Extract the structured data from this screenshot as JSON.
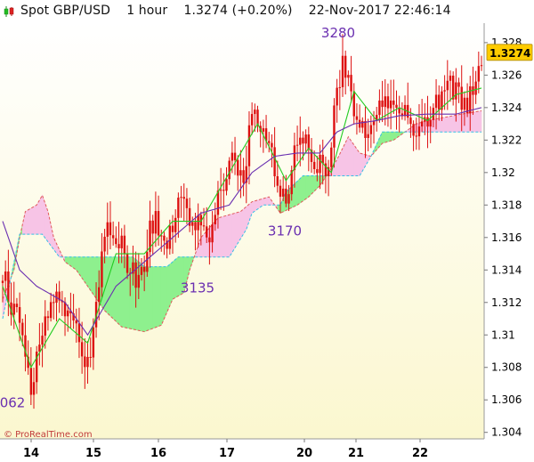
{
  "header": {
    "instrument": "Spot GBP/USD",
    "timeframe": "1 hour",
    "price": "1.3274",
    "change": "(+0.20%)",
    "datetime": "22-Nov-2017 22:46:14"
  },
  "watermark": "© ProRealTime.com",
  "colors": {
    "background_top": "#ffffff",
    "background_bottom": "#fbf7cf",
    "candle": "#dd1010",
    "tenkan": "#22cc22",
    "kijun": "#6a2fb0",
    "kumo_bull": "#8ef08e",
    "kumo_bear": "#f7c4e6",
    "senkou_a_line": "#e05a5a",
    "senkou_b_line": "#35c0e6",
    "price_tag": "#ffcc00"
  },
  "chart_data": {
    "type": "candlestick",
    "indicator": "Ichimoku",
    "ylim": [
      1.3036,
      1.3292
    ],
    "y_ticks": [
      "1.304",
      "1.306",
      "1.308",
      "1.31",
      "1.312",
      "1.314",
      "1.316",
      "1.318",
      "1.32",
      "1.322",
      "1.324",
      "1.326",
      "1.328"
    ],
    "x_ticks": [
      "14",
      "15",
      "16",
      "17",
      "20",
      "21",
      "22"
    ],
    "last_price_label": "1.3274",
    "last_price": 1.3274,
    "annotations": [
      {
        "text": "062",
        "x_day": "14",
        "y": 1.3062
      },
      {
        "text": "3135",
        "x_day": "16",
        "y": 1.3135
      },
      {
        "text": "3170",
        "x_day": "17",
        "y": 1.317
      },
      {
        "text": "3280",
        "x_day": "20",
        "y": 1.328
      }
    ],
    "close_anchors": [
      [
        0,
        1.314
      ],
      [
        3,
        1.312
      ],
      [
        6,
        1.311
      ],
      [
        8,
        1.3085
      ],
      [
        10,
        1.307
      ],
      [
        13,
        1.3095
      ],
      [
        16,
        1.3118
      ],
      [
        20,
        1.3122
      ],
      [
        23,
        1.3108
      ],
      [
        26,
        1.31
      ],
      [
        29,
        1.3085
      ],
      [
        31,
        1.3092
      ],
      [
        33,
        1.312
      ],
      [
        35,
        1.315
      ],
      [
        37,
        1.3165
      ],
      [
        40,
        1.316
      ],
      [
        43,
        1.315
      ],
      [
        45,
        1.314
      ],
      [
        48,
        1.3135
      ],
      [
        50,
        1.3145
      ],
      [
        52,
        1.317
      ],
      [
        55,
        1.3168
      ],
      [
        58,
        1.316
      ],
      [
        60,
        1.317
      ],
      [
        63,
        1.318
      ],
      [
        66,
        1.3175
      ],
      [
        68,
        1.317
      ],
      [
        70,
        1.3165
      ],
      [
        72,
        1.316
      ],
      [
        74,
        1.317
      ],
      [
        76,
        1.3185
      ],
      [
        78,
        1.319
      ],
      [
        80,
        1.321
      ],
      [
        82,
        1.32
      ],
      [
        84,
        1.3195
      ],
      [
        86,
        1.3205
      ],
      [
        88,
        1.324
      ],
      [
        90,
        1.3235
      ],
      [
        92,
        1.323
      ],
      [
        94,
        1.322
      ],
      [
        96,
        1.32
      ],
      [
        98,
        1.319
      ],
      [
        100,
        1.3175
      ],
      [
        102,
        1.3205
      ],
      [
        104,
        1.3215
      ],
      [
        107,
        1.3218
      ],
      [
        110,
        1.321
      ],
      [
        112,
        1.3205
      ],
      [
        114,
        1.3195
      ],
      [
        116,
        1.322
      ],
      [
        118,
        1.325
      ],
      [
        120,
        1.3265
      ],
      [
        122,
        1.3255
      ],
      [
        124,
        1.324
      ],
      [
        126,
        1.323
      ],
      [
        128,
        1.3228
      ],
      [
        130,
        1.3225
      ],
      [
        132,
        1.3235
      ],
      [
        134,
        1.324
      ],
      [
        136,
        1.3245
      ],
      [
        138,
        1.3242
      ],
      [
        140,
        1.324
      ],
      [
        142,
        1.3235
      ],
      [
        144,
        1.3225
      ],
      [
        146,
        1.322
      ],
      [
        148,
        1.323
      ],
      [
        150,
        1.3235
      ],
      [
        152,
        1.324
      ],
      [
        154,
        1.3245
      ],
      [
        156,
        1.325
      ],
      [
        158,
        1.3252
      ],
      [
        160,
        1.3248
      ],
      [
        162,
        1.3245
      ],
      [
        164,
        1.324
      ],
      [
        166,
        1.3255
      ],
      [
        168,
        1.327
      ],
      [
        169,
        1.3274
      ]
    ],
    "tenkan_anchors": [
      [
        0,
        1.313
      ],
      [
        10,
        1.308
      ],
      [
        20,
        1.311
      ],
      [
        30,
        1.3095
      ],
      [
        40,
        1.315
      ],
      [
        50,
        1.315
      ],
      [
        60,
        1.317
      ],
      [
        70,
        1.317
      ],
      [
        80,
        1.32
      ],
      [
        90,
        1.323
      ],
      [
        100,
        1.3195
      ],
      [
        108,
        1.3215
      ],
      [
        116,
        1.32
      ],
      [
        124,
        1.325
      ],
      [
        132,
        1.3232
      ],
      [
        140,
        1.324
      ],
      [
        150,
        1.3232
      ],
      [
        160,
        1.3248
      ],
      [
        169,
        1.3252
      ]
    ],
    "kijun_anchors": [
      [
        0,
        1.317
      ],
      [
        6,
        1.314
      ],
      [
        12,
        1.313
      ],
      [
        22,
        1.312
      ],
      [
        30,
        1.31
      ],
      [
        40,
        1.313
      ],
      [
        50,
        1.3145
      ],
      [
        60,
        1.316
      ],
      [
        70,
        1.3175
      ],
      [
        80,
        1.318
      ],
      [
        88,
        1.32
      ],
      [
        96,
        1.321
      ],
      [
        104,
        1.3212
      ],
      [
        112,
        1.3212
      ],
      [
        118,
        1.3225
      ],
      [
        124,
        1.323
      ],
      [
        132,
        1.3232
      ],
      [
        140,
        1.3235
      ],
      [
        150,
        1.3236
      ],
      [
        160,
        1.3236
      ],
      [
        169,
        1.324
      ]
    ],
    "senkou_a_anchors": [
      [
        0,
        1.3122
      ],
      [
        4,
        1.314
      ],
      [
        6,
        1.316
      ],
      [
        8,
        1.3176
      ],
      [
        12,
        1.318
      ],
      [
        14,
        1.3186
      ],
      [
        16,
        1.3176
      ],
      [
        18,
        1.316
      ],
      [
        22,
        1.3145
      ],
      [
        26,
        1.314
      ],
      [
        30,
        1.313
      ],
      [
        36,
        1.3115
      ],
      [
        42,
        1.3105
      ],
      [
        50,
        1.3102
      ],
      [
        56,
        1.3106
      ],
      [
        60,
        1.3122
      ],
      [
        64,
        1.3126
      ],
      [
        66,
        1.314
      ],
      [
        70,
        1.316
      ],
      [
        76,
        1.3172
      ],
      [
        84,
        1.3176
      ],
      [
        88,
        1.3182
      ],
      [
        94,
        1.3185
      ],
      [
        98,
        1.3175
      ],
      [
        104,
        1.318
      ],
      [
        108,
        1.3185
      ],
      [
        112,
        1.3192
      ],
      [
        118,
        1.3208
      ],
      [
        122,
        1.3222
      ],
      [
        126,
        1.3212
      ],
      [
        130,
        1.321
      ],
      [
        134,
        1.3218
      ],
      [
        138,
        1.322
      ],
      [
        142,
        1.3225
      ],
      [
        146,
        1.323
      ],
      [
        150,
        1.3232
      ],
      [
        156,
        1.3234
      ],
      [
        162,
        1.3236
      ],
      [
        169,
        1.3238
      ]
    ],
    "senkou_b_anchors": [
      [
        0,
        1.311
      ],
      [
        6,
        1.3162
      ],
      [
        14,
        1.3162
      ],
      [
        20,
        1.3148
      ],
      [
        26,
        1.3148
      ],
      [
        36,
        1.3148
      ],
      [
        46,
        1.3148
      ],
      [
        50,
        1.3142
      ],
      [
        58,
        1.3142
      ],
      [
        62,
        1.3148
      ],
      [
        70,
        1.3148
      ],
      [
        80,
        1.3148
      ],
      [
        86,
        1.3165
      ],
      [
        88,
        1.3175
      ],
      [
        92,
        1.318
      ],
      [
        98,
        1.318
      ],
      [
        100,
        1.3188
      ],
      [
        106,
        1.3198
      ],
      [
        120,
        1.3198
      ],
      [
        126,
        1.3198
      ],
      [
        130,
        1.321
      ],
      [
        134,
        1.3225
      ],
      [
        140,
        1.3225
      ],
      [
        150,
        1.3225
      ],
      [
        160,
        1.3225
      ],
      [
        169,
        1.3225
      ]
    ]
  }
}
